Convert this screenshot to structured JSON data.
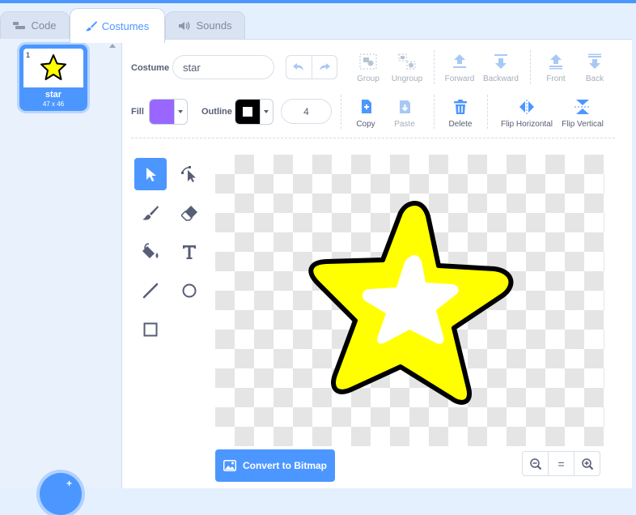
{
  "tabs": [
    {
      "label": "Code",
      "icon": "code-icon"
    },
    {
      "label": "Costumes",
      "icon": "brush-icon"
    },
    {
      "label": "Sounds",
      "icon": "speaker-icon"
    }
  ],
  "costume_list": [
    {
      "number": "1",
      "name": "star",
      "size": "47 x 46"
    }
  ],
  "editor": {
    "costume_label": "Costume",
    "costume_name": "star",
    "fill_label": "Fill",
    "outline_label": "Outline",
    "outline_width": "4",
    "fill_color": "#9966ff",
    "outline_color": "#000000",
    "buttons": {
      "group": "Group",
      "ungroup": "Ungroup",
      "forward": "Forward",
      "backward": "Backward",
      "front": "Front",
      "back": "Back",
      "copy": "Copy",
      "paste": "Paste",
      "delete": "Delete",
      "flip_horizontal": "Flip Horizontal",
      "flip_vertical": "Flip Vertical"
    },
    "tools": [
      "select-icon",
      "reshape-icon",
      "brush-icon",
      "eraser-icon",
      "fill-icon",
      "text-icon",
      "line-icon",
      "circle-icon",
      "rectangle-icon"
    ],
    "selected_tool": "select",
    "convert_button": "Convert to Bitmap",
    "zoom": {
      "out": "zoom-out-icon",
      "reset": "=",
      "in": "zoom-in-icon"
    }
  },
  "colors": {
    "accent": "#4c97ff",
    "star_fill": "#ffff00",
    "star_outline": "#000000",
    "delete": "#4c97ff"
  }
}
